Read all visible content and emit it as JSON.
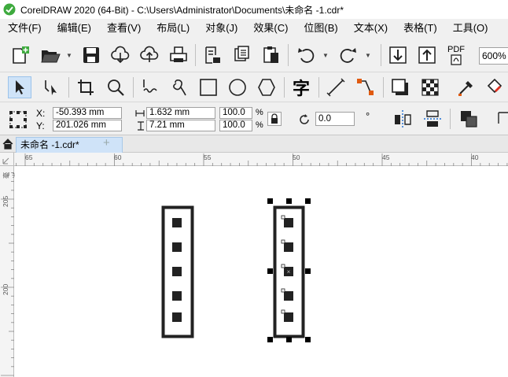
{
  "window": {
    "title": "CorelDRAW 2020 (64-Bit) - C:\\Users\\Administrator\\Documents\\未命名 -1.cdr*"
  },
  "menu": [
    {
      "label": "文件(F)"
    },
    {
      "label": "编辑(E)"
    },
    {
      "label": "查看(V)"
    },
    {
      "label": "布局(L)"
    },
    {
      "label": "对象(J)"
    },
    {
      "label": "效果(C)"
    },
    {
      "label": "位图(B)"
    },
    {
      "label": "文本(X)"
    },
    {
      "label": "表格(T)"
    },
    {
      "label": "工具(O)"
    }
  ],
  "toolbar": {
    "pdf_label": "PDF",
    "zoom_value": "600%"
  },
  "toolbox": {
    "text_tool_glyph": "字"
  },
  "properties": {
    "x_label": "X:",
    "y_label": "Y:",
    "x_value": "-50.393 mm",
    "y_value": "201.026 mm",
    "width_value": "1.632 mm",
    "height_value": "7.21 mm",
    "scale_w": "100.0",
    "scale_h": "100.0",
    "percent_w": "%",
    "percent_h": "%",
    "rotation_value": "0.0",
    "degree_symbol": "°"
  },
  "document_tab": {
    "label": "未命名 -1.cdr*",
    "add": "+"
  },
  "rulers": {
    "unit": "毫米",
    "h_labels": [
      "65",
      "60",
      "55",
      "50",
      "45",
      "40"
    ],
    "v_labels": [
      "205",
      "200"
    ]
  },
  "colors": {
    "app_icon_green": "#3eaa3e",
    "accent_orange": "#e05a10",
    "accent_blue": "#1a6ad0",
    "tab_active": "#cfe3f8"
  }
}
